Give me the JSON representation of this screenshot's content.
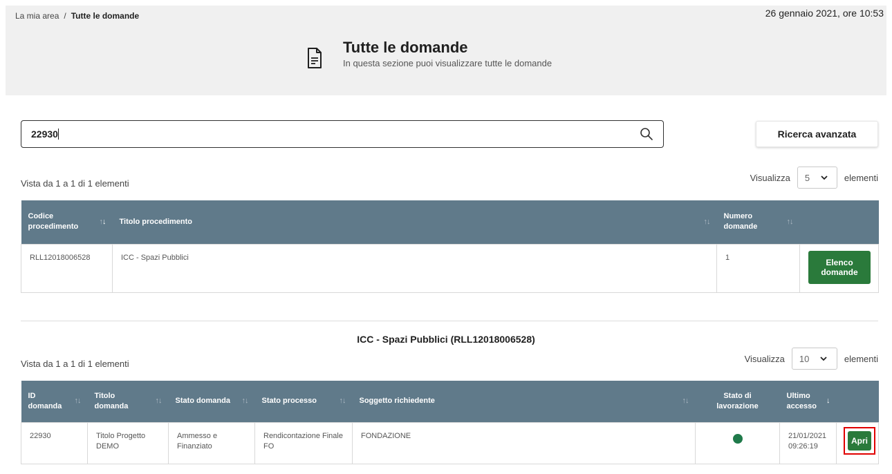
{
  "breadcrumb": {
    "home": "La mia area",
    "separator": "/",
    "current": "Tutte le domande"
  },
  "datetime": "26 gennaio 2021, ore 10:53",
  "header": {
    "title": "Tutte le domande",
    "subtitle": "In questa sezione puoi visualizzare tutte le domande",
    "icon": "document-icon"
  },
  "search": {
    "value": "22930",
    "icon": "search-icon"
  },
  "advanced_search_label": "Ricerca avanzata",
  "procedures": {
    "summary": "Vista da 1 a 1 di 1 elementi",
    "show_label": "Visualizza",
    "page_size": "5",
    "elements_label": "elementi",
    "columns": {
      "code_line1": "Codice",
      "code_line2": "procedimento",
      "title": "Titolo procedimento",
      "count_line1": "Numero",
      "count_line2": "domande"
    },
    "rows": [
      {
        "code": "RLL12018006528",
        "title": "ICC - Spazi Pubblici",
        "count": "1",
        "action_line1": "Elenco",
        "action_line2": "domande"
      }
    ]
  },
  "applications": {
    "section_title": "ICC - Spazi Pubblici (RLL12018006528)",
    "summary": "Vista da 1 a 1 di 1 elementi",
    "show_label": "Visualizza",
    "page_size": "10",
    "elements_label": "elementi",
    "columns": {
      "id_line1": "ID",
      "id_line2": "domanda",
      "title_line1": "Titolo",
      "title_line2": "domanda",
      "status": "Stato domanda",
      "process": "Stato processo",
      "applicant": "Soggetto richiedente",
      "work_line1": "Stato di",
      "work_line2": "lavorazione",
      "access_line1": "Ultimo",
      "access_line2": "accesso"
    },
    "rows": [
      {
        "id": "22930",
        "title_line1": "Titolo Progetto",
        "title_line2": "DEMO",
        "status_line1": "Ammesso e",
        "status_line2": "Finanziato",
        "process_line1": "Rendicontazione Finale",
        "process_line2": "FO",
        "applicant": "FONDAZIONE",
        "work_status_color": "#1f7a4a",
        "access_date": "21/01/2021",
        "access_time": "09:26:19",
        "action": "Apri"
      }
    ]
  },
  "colors": {
    "header_bg": "#607a8a",
    "button_green": "#2a7a3b",
    "highlight": "#e00000"
  }
}
